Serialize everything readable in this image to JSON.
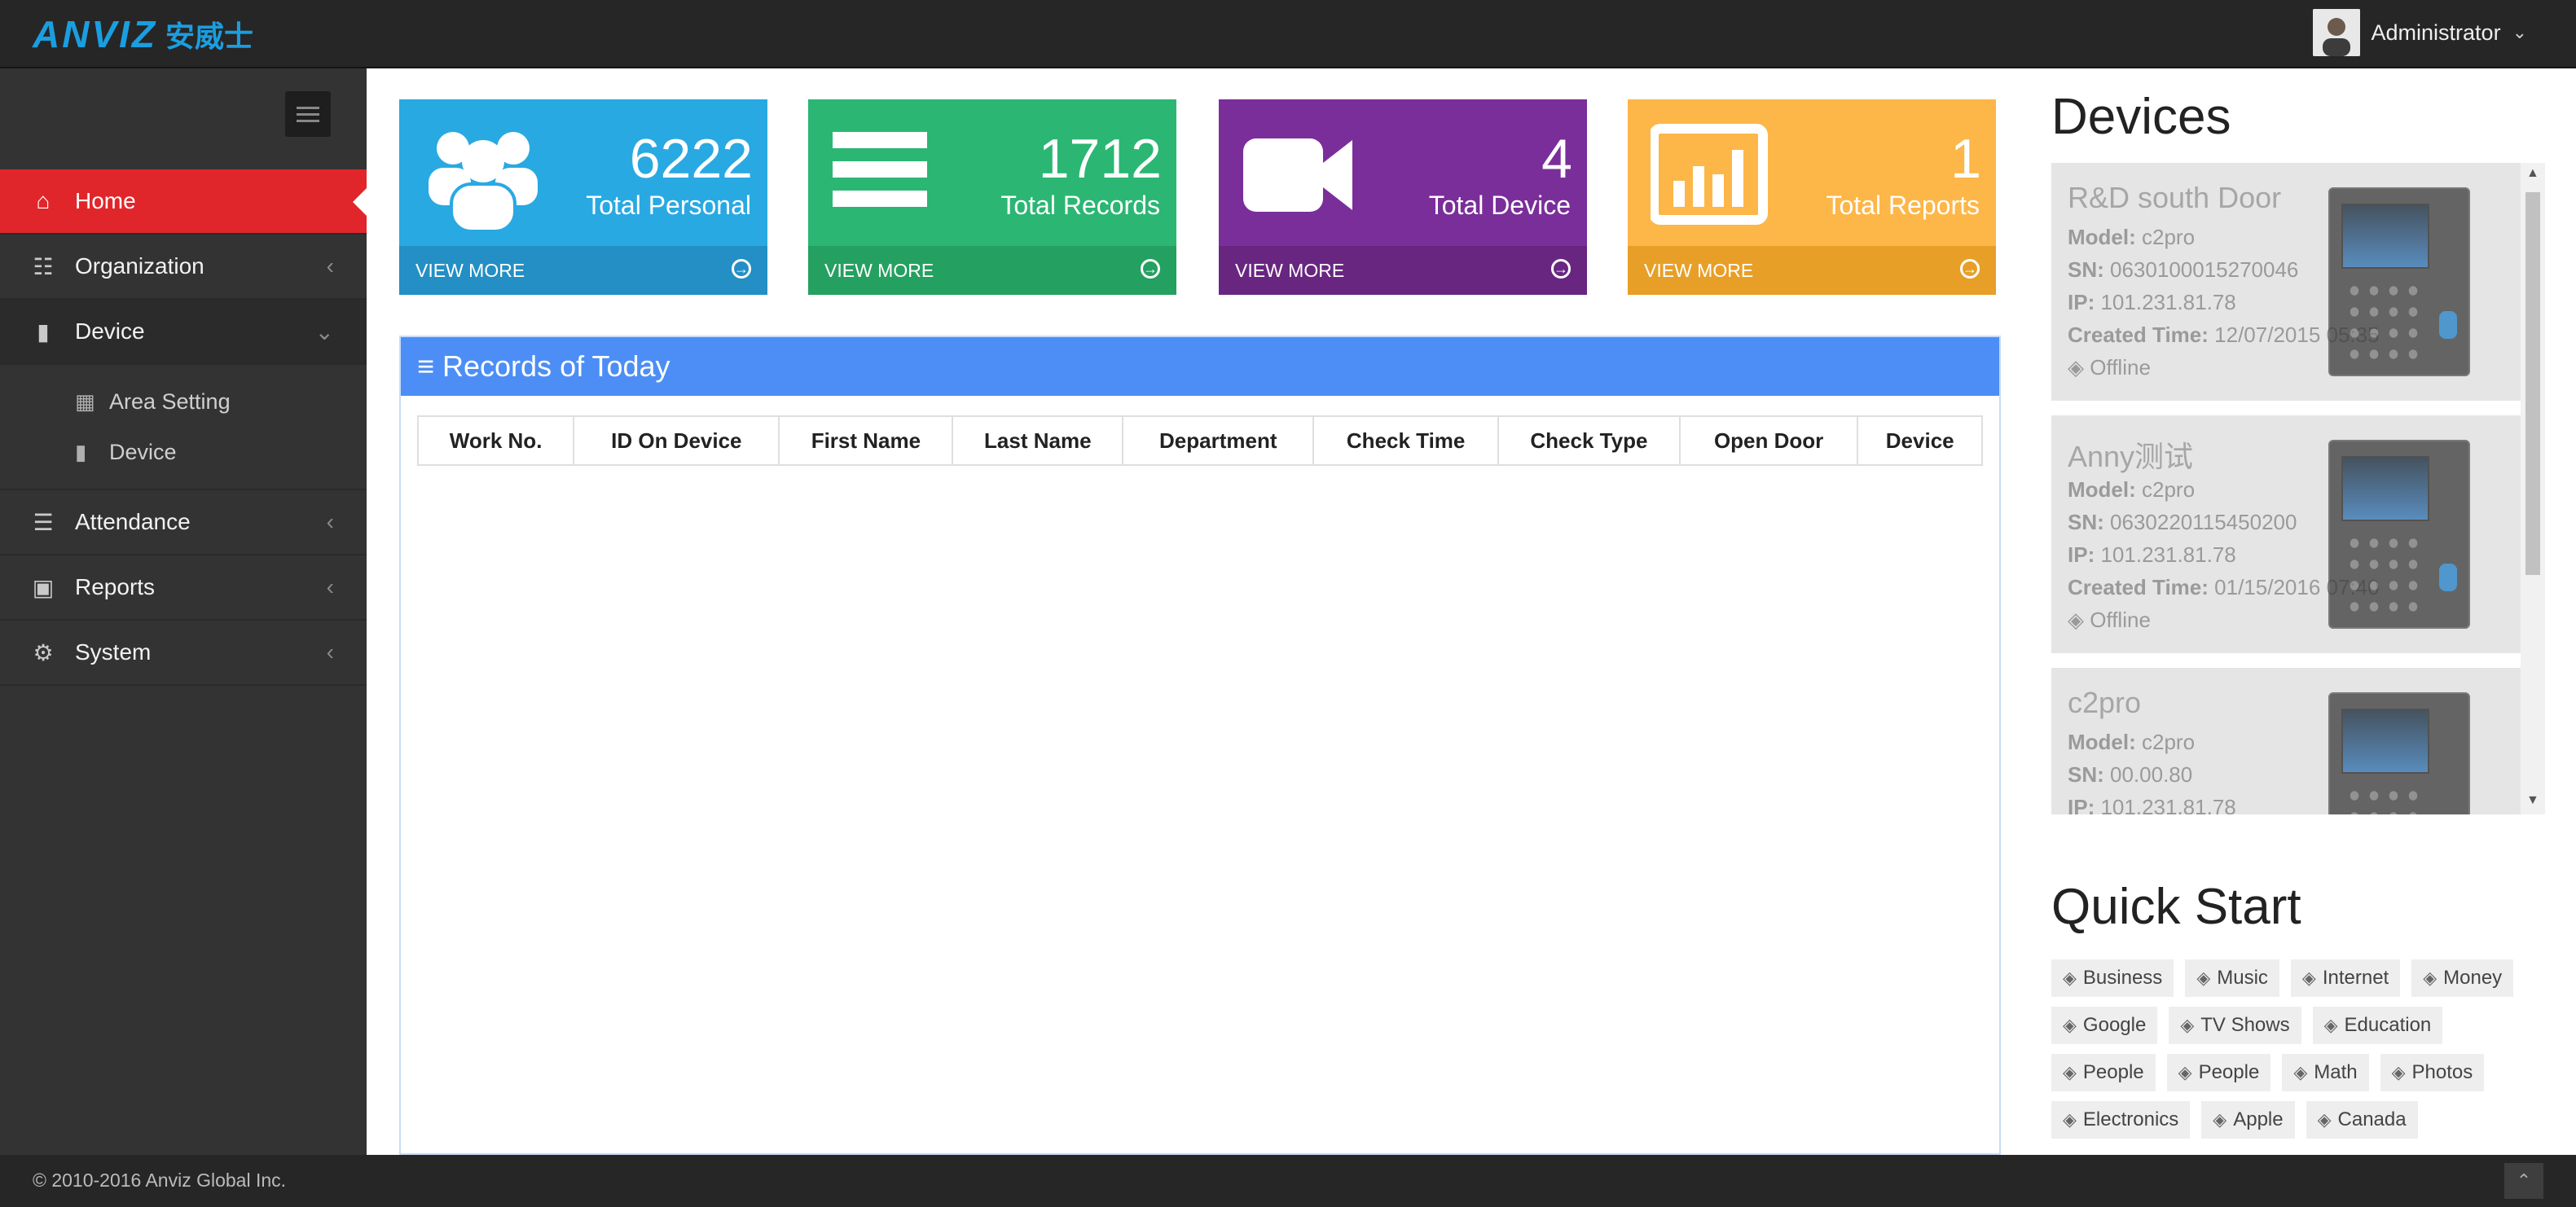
{
  "header": {
    "logo_en": "ANVIZ",
    "logo_cn": "安威士",
    "user_name": "Administrator"
  },
  "sidebar": {
    "items": [
      {
        "label": "Home",
        "icon": "home-icon"
      },
      {
        "label": "Organization",
        "icon": "sitemap-icon"
      },
      {
        "label": "Device",
        "icon": "video-camera-icon"
      },
      {
        "label": "Attendance",
        "icon": "list-icon"
      },
      {
        "label": "Reports",
        "icon": "file-icon"
      },
      {
        "label": "System",
        "icon": "gears-icon"
      }
    ],
    "device_sub": [
      {
        "label": "Area Setting",
        "icon": "grid-icon"
      },
      {
        "label": "Device",
        "icon": "video-camera-icon"
      }
    ]
  },
  "cards": [
    {
      "value": "6222",
      "label": "Total Personal",
      "more": "VIEW MORE",
      "icon": "users-icon",
      "color": "#29a9e2"
    },
    {
      "value": "1712",
      "label": "Total Records",
      "more": "VIEW MORE",
      "icon": "bars-icon",
      "color": "#2bb673"
    },
    {
      "value": "4",
      "label": "Total Device",
      "more": "VIEW MORE",
      "icon": "video-camera-icon",
      "color": "#7a2e9a"
    },
    {
      "value": "1",
      "label": "Total Reports",
      "more": "VIEW MORE",
      "icon": "bar-chart-icon",
      "color": "#fdb648"
    }
  ],
  "records": {
    "title": "Records of Today",
    "columns": [
      "Work No.",
      "ID On Device",
      "First Name",
      "Last Name",
      "Department",
      "Check Time",
      "Check Type",
      "Open Door",
      "Device"
    ]
  },
  "devices": {
    "title": "Devices",
    "labels": {
      "model": "Model:",
      "sn": "SN:",
      "ip": "IP:",
      "created": "Created Time:"
    },
    "list": [
      {
        "name": "R&D south Door",
        "model": "c2pro",
        "sn": "0630100015270046",
        "ip": "101.231.81.78",
        "created": "12/07/2015 05:35",
        "status": "Offline"
      },
      {
        "name": "Anny测试",
        "model": "c2pro",
        "sn": "0630220115450200",
        "ip": "101.231.81.78",
        "created": "01/15/2016 07:40",
        "status": "Offline"
      },
      {
        "name": "c2pro",
        "model": "c2pro",
        "sn": "00.00.80",
        "ip": "101.231.81.78",
        "created": "",
        "status": ""
      }
    ]
  },
  "quick_start": {
    "title": "Quick Start",
    "tags": [
      "Business",
      "Music",
      "Internet",
      "Money",
      "Google",
      "TV Shows",
      "Education",
      "People",
      "People",
      "Math",
      "Photos",
      "Electronics",
      "Apple",
      "Canada"
    ]
  },
  "footer": {
    "copyright": "© 2010-2016 Anviz Global Inc."
  }
}
